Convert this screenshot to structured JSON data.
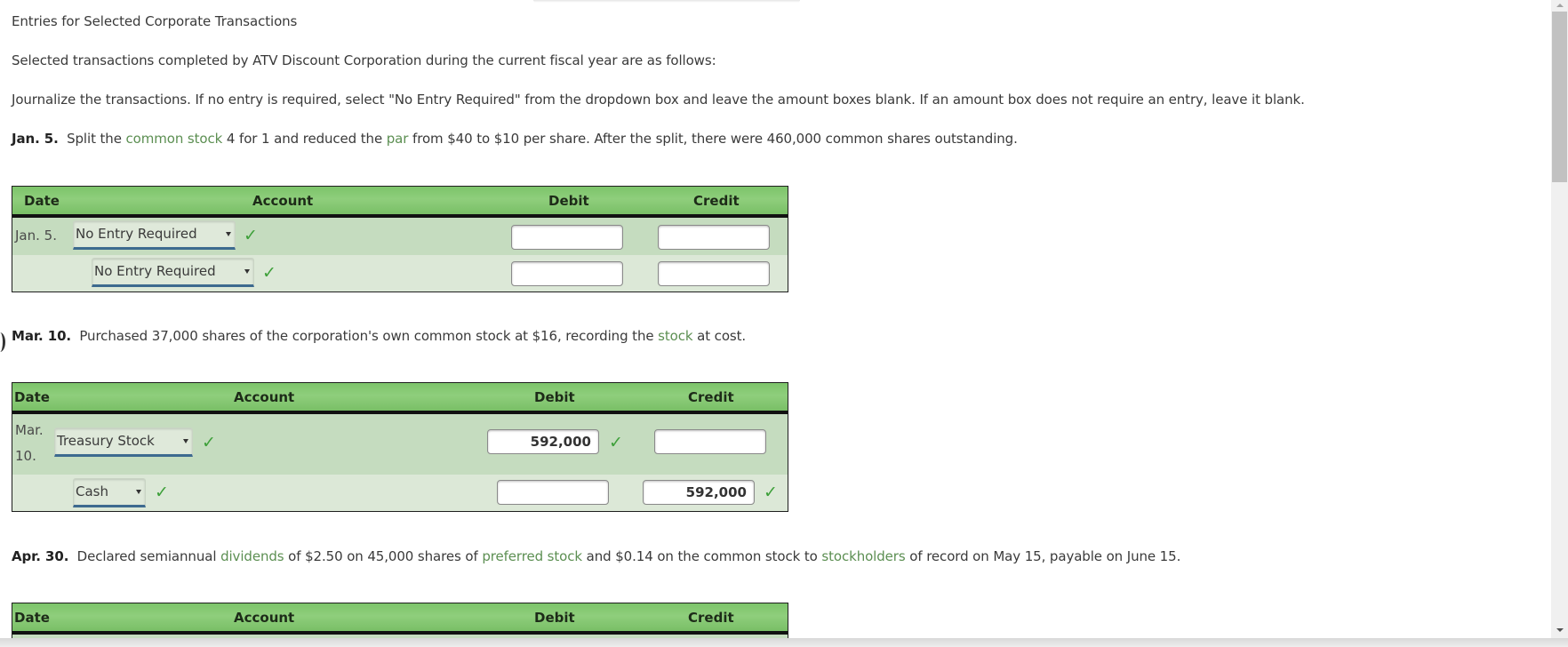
{
  "title": "Entries for Selected Corporate Transactions",
  "intro": "Selected transactions completed by ATV Discount Corporation during the current fiscal year are as follows:",
  "instructions": "Journalize the transactions. If no entry is required, select \"No Entry Required\" from the dropdown box and leave the amount boxes blank. If an amount box does not require an entry, leave it blank.",
  "colors": {
    "header_green": "#8fce7c",
    "row_dark": "#c5dcbf",
    "row_light": "#dce8d7",
    "keyword_green": "#5c8f52",
    "check_green": "#3ea03a"
  },
  "transactions": [
    {
      "date_label": "Jan. 5.",
      "text_parts": [
        "Split the ",
        "common stock",
        " 4 for 1 and reduced the ",
        "par",
        " from $40 to $10 per share. After the split, there were 460,000 common shares outstanding."
      ],
      "table": {
        "headers": {
          "date": "Date",
          "account": "Account",
          "debit": "Debit",
          "credit": "Credit"
        },
        "rows": [
          {
            "date": "Jan. 5.",
            "account": "No Entry Required",
            "account_correct": true,
            "debit": "",
            "credit": "",
            "debit_correct": false,
            "credit_correct": false
          },
          {
            "date": "",
            "account": "No Entry Required",
            "account_correct": true,
            "debit": "",
            "credit": "",
            "debit_correct": false,
            "credit_correct": false
          }
        ]
      }
    },
    {
      "date_label": "Mar. 10.",
      "text_parts": [
        "Purchased 37,000 shares of the corporation's own common stock at $16, recording the ",
        "stock",
        " at cost."
      ],
      "table": {
        "headers": {
          "date": "Date",
          "account": "Account",
          "debit": "Debit",
          "credit": "Credit"
        },
        "rows": [
          {
            "date_line1": "Mar.",
            "date_line2": "10.",
            "account": "Treasury Stock",
            "account_correct": true,
            "debit": "592,000",
            "debit_correct": true,
            "credit": ""
          },
          {
            "date": "",
            "account": "Cash",
            "account_correct": true,
            "debit": "",
            "credit": "592,000",
            "credit_correct": true
          }
        ]
      }
    },
    {
      "date_label": "Apr. 30.",
      "text_parts": [
        "Declared semiannual ",
        "dividends",
        " of $2.50 on 45,000 shares of ",
        "preferred stock",
        " and $0.14 on the common stock to ",
        "stockholders",
        " of record on May 15, payable on June 15."
      ],
      "table": {
        "headers": {
          "date": "Date",
          "account": "Account",
          "debit": "Debit",
          "credit": "Credit"
        }
      }
    }
  ],
  "icons": {
    "check": "✓",
    "dropdown_caret": "caret-down-icon"
  }
}
